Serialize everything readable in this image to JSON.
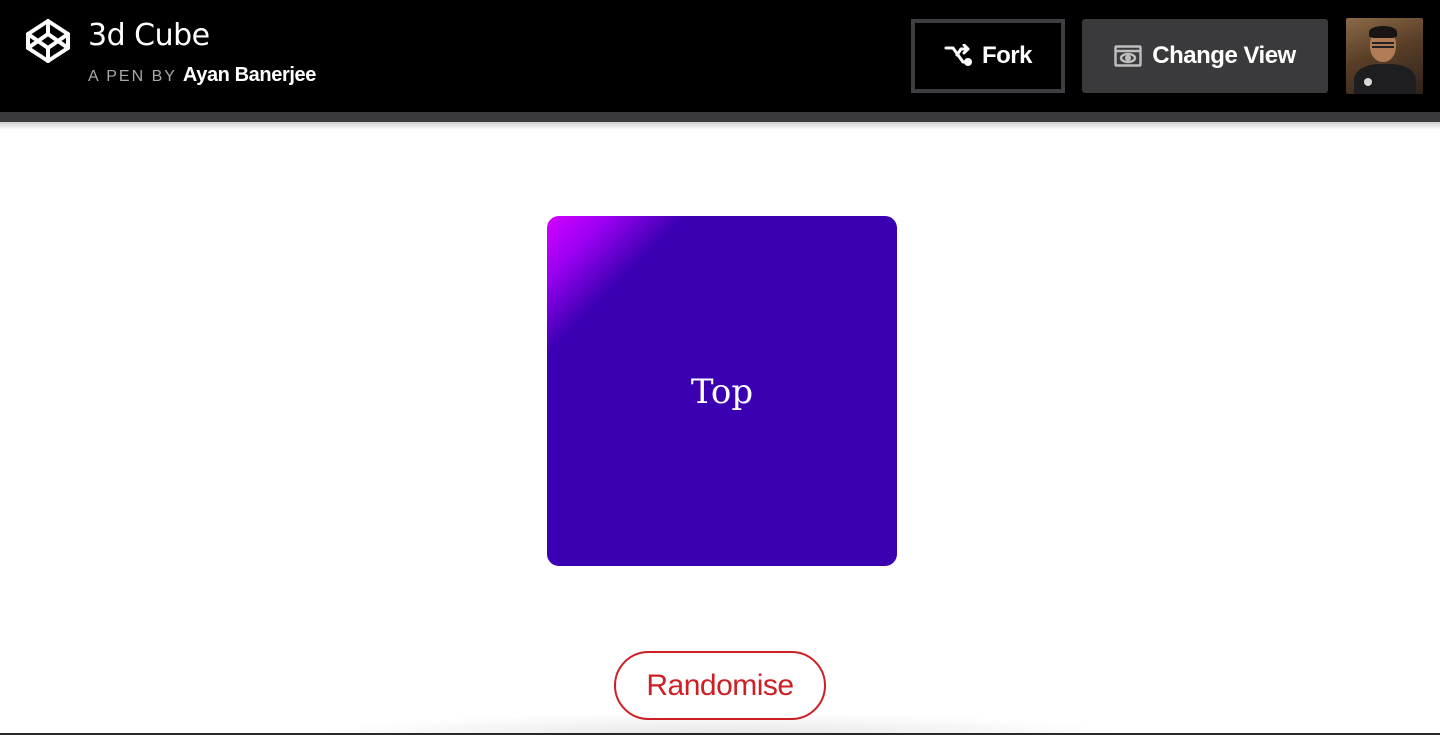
{
  "header": {
    "title": "3d Cube",
    "byline_prefix": "A PEN BY",
    "author": "Ayan Banerjee",
    "fork_label": "Fork",
    "change_view_label": "Change View",
    "logo_icon": "codepen-logo-icon",
    "fork_icon": "fork-icon",
    "change_view_icon": "eye-icon"
  },
  "cube": {
    "face_label": "Top",
    "face_color": "#3a00b2",
    "highlight_color": "#d400ff"
  },
  "controls": {
    "randomise_label": "Randomise",
    "accent_color": "#cc1f26"
  }
}
